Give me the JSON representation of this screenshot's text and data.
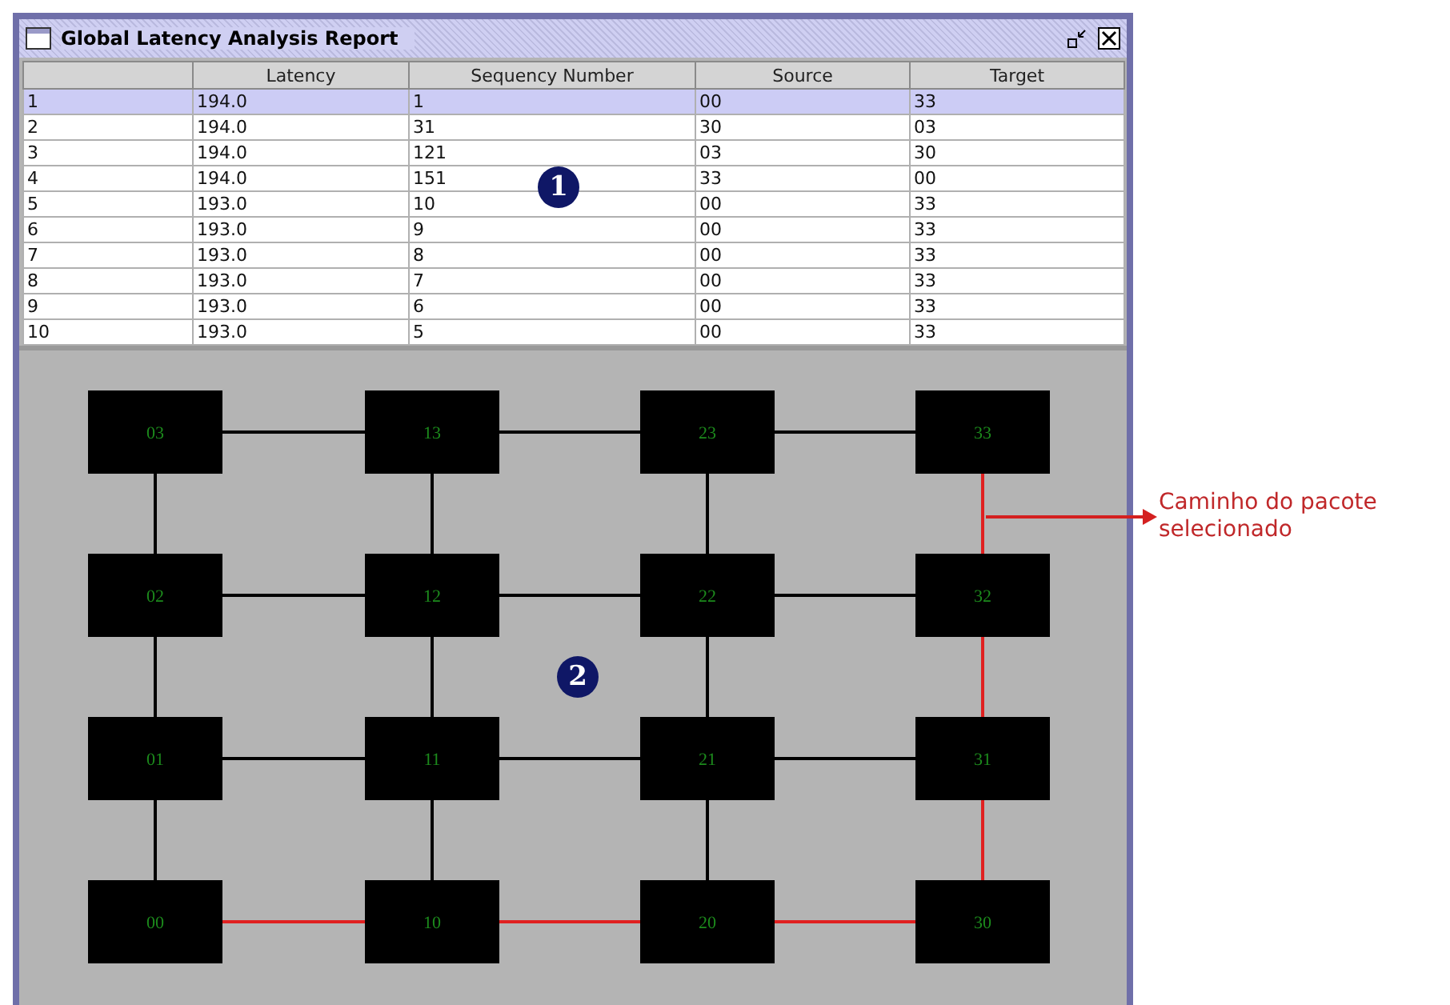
{
  "window": {
    "title": "Global Latency Analysis Report"
  },
  "table": {
    "columns": [
      "Latency",
      "Sequency Number",
      "Source",
      "Target"
    ],
    "rows": [
      {
        "index": "1",
        "cells": [
          "194.0",
          "1",
          "00",
          "33"
        ],
        "selected": true
      },
      {
        "index": "2",
        "cells": [
          "194.0",
          "31",
          "30",
          "03"
        ],
        "selected": false
      },
      {
        "index": "3",
        "cells": [
          "194.0",
          "121",
          "03",
          "30"
        ],
        "selected": false
      },
      {
        "index": "4",
        "cells": [
          "194.0",
          "151",
          "33",
          "00"
        ],
        "selected": false
      },
      {
        "index": "5",
        "cells": [
          "193.0",
          "10",
          "00",
          "33"
        ],
        "selected": false
      },
      {
        "index": "6",
        "cells": [
          "193.0",
          "9",
          "00",
          "33"
        ],
        "selected": false
      },
      {
        "index": "7",
        "cells": [
          "193.0",
          "8",
          "00",
          "33"
        ],
        "selected": false
      },
      {
        "index": "8",
        "cells": [
          "193.0",
          "7",
          "00",
          "33"
        ],
        "selected": false
      },
      {
        "index": "9",
        "cells": [
          "193.0",
          "6",
          "00",
          "33"
        ],
        "selected": false
      },
      {
        "index": "10",
        "cells": [
          "193.0",
          "5",
          "00",
          "33"
        ],
        "selected": false
      }
    ],
    "marker": "1"
  },
  "network": {
    "marker": "2",
    "grid": [
      [
        {
          "label": "03",
          "right_on_path": false,
          "down_on_path": false
        },
        {
          "label": "13",
          "right_on_path": false,
          "down_on_path": false
        },
        {
          "label": "23",
          "right_on_path": false,
          "down_on_path": false
        },
        {
          "label": "33",
          "down_on_path": true
        }
      ],
      [
        {
          "label": "02",
          "right_on_path": false,
          "down_on_path": false
        },
        {
          "label": "12",
          "right_on_path": false,
          "down_on_path": false
        },
        {
          "label": "22",
          "right_on_path": false,
          "down_on_path": false
        },
        {
          "label": "32",
          "down_on_path": true
        }
      ],
      [
        {
          "label": "01",
          "right_on_path": false,
          "down_on_path": false
        },
        {
          "label": "11",
          "right_on_path": false,
          "down_on_path": false
        },
        {
          "label": "21",
          "right_on_path": false,
          "down_on_path": false
        },
        {
          "label": "31",
          "down_on_path": true
        }
      ],
      [
        {
          "label": "00",
          "right_on_path": true
        },
        {
          "label": "10",
          "right_on_path": true
        },
        {
          "label": "20",
          "right_on_path": true
        },
        {
          "label": "30"
        }
      ]
    ]
  },
  "callout": {
    "text": "Caminho do pacote selecionado"
  }
}
